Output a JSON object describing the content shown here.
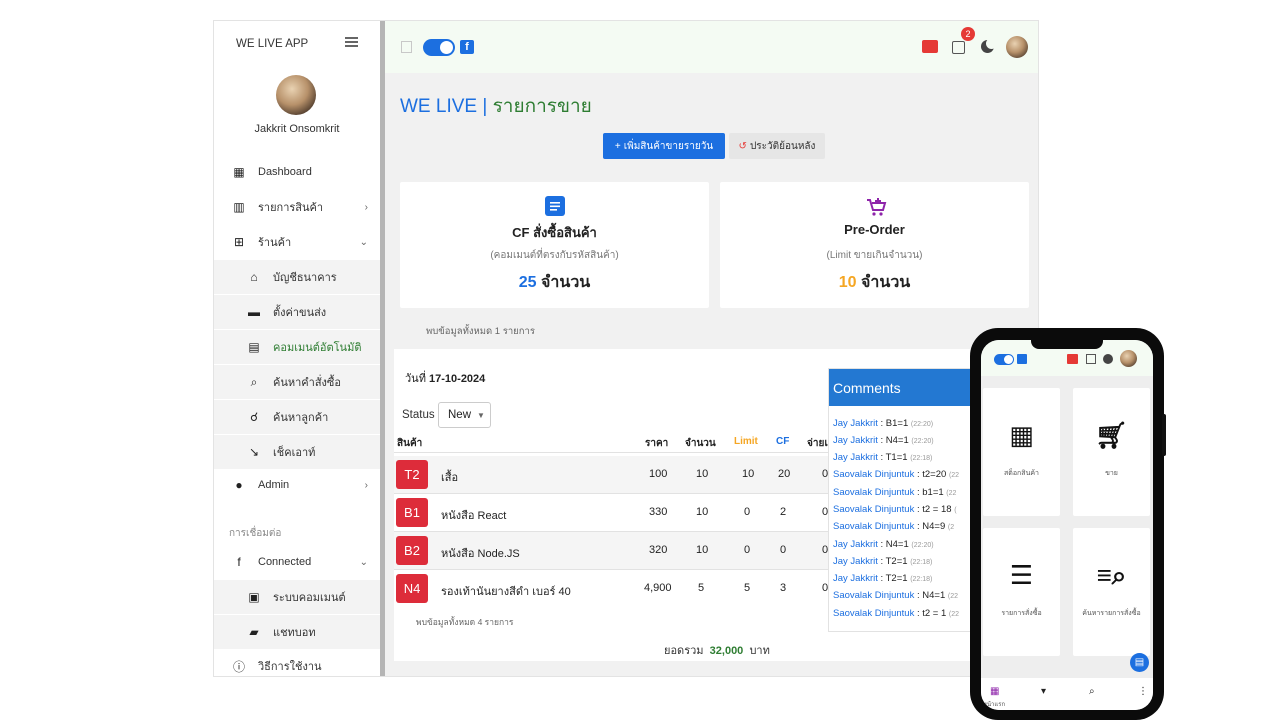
{
  "app": {
    "name": "WE LIVE APP"
  },
  "user": {
    "name": "Jakkrit Onsomkrit"
  },
  "sidebar": {
    "items": [
      {
        "label": "Dashboard",
        "icon": "dashboard-icon"
      },
      {
        "label": "รายการสินค้า",
        "icon": "map-icon"
      },
      {
        "label": "ร้านค้า",
        "icon": "store-icon"
      },
      {
        "label": "บัญชีธนาคาร",
        "icon": "bank-icon"
      },
      {
        "label": "ตั้งค่าขนส่ง",
        "icon": "truck-icon"
      },
      {
        "label": "คอมเมนต์อัตโนมัติ",
        "icon": "comment-icon"
      },
      {
        "label": "ค้นหาคำสั่งซื้อ",
        "icon": "order-search-icon"
      },
      {
        "label": "ค้นหาลูกค้า",
        "icon": "customer-search-icon"
      },
      {
        "label": "เช็คเอาท์",
        "icon": "checkout-icon"
      },
      {
        "label": "Admin",
        "icon": "admin-icon"
      }
    ],
    "section_label": "การเชื่อมต่อ",
    "connect_items": [
      {
        "label": "Connected",
        "icon": "facebook-icon"
      },
      {
        "label": "ระบบคอมเมนต์",
        "icon": "feed-icon"
      },
      {
        "label": "แชทบอท",
        "icon": "chat-icon"
      },
      {
        "label": "วิธีการใช้งาน",
        "icon": "info-icon"
      }
    ]
  },
  "topbar": {
    "notification_count": "2"
  },
  "page": {
    "title": "WE LIVE |",
    "subtitle": "รายการขาย",
    "add_button": "เพิ่มสินค้าขายรายวัน",
    "history_button": "ประวัติย้อนหลัง"
  },
  "cards": [
    {
      "title": "CF สั่งซื้อสินค้า",
      "desc": "(คอมเมนต์ที่ตรงกับรหัสสินค้า)",
      "count": "25",
      "unit": "จำนวน",
      "icon": "list-icon"
    },
    {
      "title": "Pre-Order",
      "desc": "(Limit ขายเกินจำนวน)",
      "count": "10",
      "unit": "จำนวน",
      "icon": "cart-plus-icon"
    }
  ],
  "found_summary": "พบข้อมูลทั้งหมด 1 รายการ",
  "sales": {
    "date_label": "วันที่",
    "date": "17-10-2024",
    "status_label": "Status",
    "status_value": "New",
    "headers": {
      "product": "สินค้า",
      "price": "ราคา",
      "qty": "จำนวน",
      "limit": "Limit",
      "cf": "CF",
      "paid": "จ่ายแ"
    },
    "rows": [
      {
        "code": "T2",
        "name": "เสื้อ",
        "price": "100",
        "qty": "10",
        "limit": "10",
        "cf": "20",
        "paid": "0"
      },
      {
        "code": "B1",
        "name": "หนังสือ React",
        "price": "330",
        "qty": "10",
        "limit": "0",
        "cf": "2",
        "paid": "0"
      },
      {
        "code": "B2",
        "name": "หนังสือ Node.JS",
        "price": "320",
        "qty": "10",
        "limit": "0",
        "cf": "0",
        "paid": "0"
      },
      {
        "code": "N4",
        "name": "รองเท้านันยางสีดำ เบอร์ 40",
        "price": "4,900",
        "qty": "5",
        "limit": "5",
        "cf": "3",
        "paid": "0"
      }
    ],
    "found": "พบข้อมูลทั้งหมด 4 รายการ",
    "total_label": "ยอดรวม",
    "total_value": "32,000",
    "total_unit": "บาท"
  },
  "comments": {
    "title": "Comments",
    "items": [
      {
        "name": "Jay Jakkrit",
        "text": " : B1=1 ",
        "time": "(22:20)"
      },
      {
        "name": "Jay Jakkrit",
        "text": " : N4=1 ",
        "time": "(22:20)"
      },
      {
        "name": "Jay Jakkrit",
        "text": " : T1=1 ",
        "time": "(22:18)"
      },
      {
        "name": "Saovalak Dinjuntuk",
        "text": " : t2=20 ",
        "time": "(22"
      },
      {
        "name": "Saovalak Dinjuntuk",
        "text": " : b1=1 ",
        "time": "(22"
      },
      {
        "name": "Saovalak Dinjuntuk",
        "text": " : t2 = 18 ",
        "time": "("
      },
      {
        "name": "Saovalak Dinjuntuk",
        "text": " : N4=9 ",
        "time": "(2"
      },
      {
        "name": "Jay Jakkrit",
        "text": " : N4=1 ",
        "time": "(22:20)"
      },
      {
        "name": "Jay Jakkrit",
        "text": " : T2=1 ",
        "time": "(22:18)"
      },
      {
        "name": "Jay Jakkrit",
        "text": " : T2=1 ",
        "time": "(22:18)"
      },
      {
        "name": "Saovalak Dinjuntuk",
        "text": " : N4=1 ",
        "time": "(22"
      },
      {
        "name": "Saovalak Dinjuntuk",
        "text": " : t2 = 1 ",
        "time": "(22"
      }
    ]
  },
  "mobile": {
    "tiles": [
      {
        "label": "สต็อกสินค้า",
        "icon": "calculator-icon"
      },
      {
        "label": "ขาย",
        "icon": "cart-icon"
      },
      {
        "label": "รายการสั่งซื้อ",
        "icon": "numbered-list-icon"
      },
      {
        "label": "ค้นหารายการสั่งซื้อ",
        "icon": "search-list-icon"
      }
    ],
    "nav_label": "หน้าแรก"
  },
  "colors": {
    "primary": "#1c6fe0",
    "green": "#2e7d32",
    "red": "#dd2c3a",
    "orange": "#f5a623"
  }
}
